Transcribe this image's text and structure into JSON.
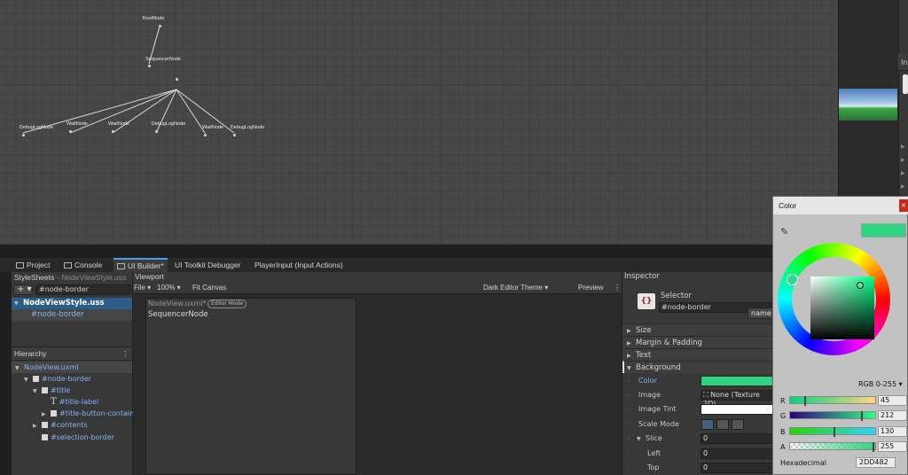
{
  "graph": {
    "nodes": {
      "root": "RootNode",
      "sequencer": "SequencerNode",
      "child1": "DebugLogNode",
      "child2": "WaitNode",
      "child3": "WaitNode",
      "child4": "DebugLogNode",
      "child5": "WaitNode",
      "child6": "DebugLogNode"
    }
  },
  "right_panel": {
    "label": "Ins"
  },
  "tabs": [
    "Project",
    "Console",
    "UI Builder*",
    "UI Toolkit Debugger",
    "PlayerInput (Input Actions)"
  ],
  "stylesheets": {
    "title": "StyleSheets",
    "subtitle": "- NodeViewStyle.uss",
    "add_label": "+ ▾",
    "selector_value": "#node-border",
    "file": "NodeViewStyle.uss",
    "selector_item": "#node-border"
  },
  "hierarchy": {
    "title": "Hierarchy",
    "root": "NodeView.uxml",
    "items": [
      "#node-border",
      "#title",
      "#title-label",
      "#title-button-contain",
      "#contents",
      "#selection-border"
    ]
  },
  "viewport": {
    "title": "Viewport",
    "file_menu": "File ▾",
    "zoom": "100% ▾",
    "fit": "Fit Canvas",
    "theme": "Dark Editor Theme ▾",
    "preview": "Preview",
    "canvas_file": "NodeView.uxml*",
    "mode": "Editor Mode",
    "node_text": "SequencerNode"
  },
  "inspector": {
    "title": "Inspector",
    "selector_label": "Selector",
    "selector_value": "#node-border",
    "name_btn": "name",
    "sections": [
      "Size",
      "Margin & Padding",
      "Text",
      "Background"
    ],
    "props": {
      "color": "Color",
      "image": "Image",
      "image_value": "None (Texture 2D)",
      "image_tint": "Image Tint",
      "scale_mode": "Scale Mode",
      "slice": "Slice",
      "slice_value": "0",
      "left": "Left",
      "left_value": "0",
      "top": "Top",
      "top_value": "0"
    }
  },
  "color_picker": {
    "title": "Color",
    "close": "✕",
    "mode": "RGB 0-255 ▾",
    "channels": [
      {
        "name": "R",
        "value": "45"
      },
      {
        "name": "G",
        "value": "212"
      },
      {
        "name": "B",
        "value": "130"
      },
      {
        "name": "A",
        "value": "255"
      }
    ],
    "hex_label": "Hexadecimal",
    "hex": "2DD482",
    "current_color": "#2DD482"
  }
}
